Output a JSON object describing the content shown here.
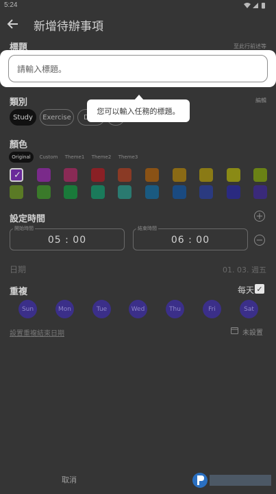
{
  "status_bar": {
    "time": "5:24"
  },
  "app_bar": {
    "title": "新增待辦事項"
  },
  "title_section": {
    "label": "標題",
    "hint_right": "至此行前述等",
    "input_placeholder": "請輸入標題。"
  },
  "tooltip": {
    "text": "您可以輸入任務的標題。"
  },
  "category_section": {
    "label": "類別",
    "edit_label": "編輯",
    "chips": [
      "Study",
      "Exercise",
      "D"
    ],
    "selected": "Study"
  },
  "color_section": {
    "label": "顏色",
    "theme_tabs": [
      "Original",
      "Custom",
      "Theme1",
      "Theme2",
      "Theme3"
    ],
    "selected_tab": "Original",
    "swatches_row1": [
      "#6a2a9a",
      "#7a2a8a",
      "#8a2a55",
      "#8a2025",
      "#8a3a25",
      "#8a5215",
      "#8a6a15",
      "#8a7a15",
      "#8a8a15",
      "#6a8215"
    ],
    "swatches_row2": [
      "#5a7a25",
      "#3a7a2a",
      "#1a7a3a",
      "#1a7a5a",
      "#2a7a70",
      "#1a5a80",
      "#1a4a80",
      "#2a3a80",
      "#2a2a80",
      "#3a2a7a"
    ],
    "selected_swatch": 0
  },
  "time_section": {
    "label": "設定時間",
    "start_caption": "開始時間",
    "start_value": "05 : 00",
    "end_caption": "結束時間",
    "end_value": "06 : 00"
  },
  "date_section": {
    "label": "日期",
    "value": "01. 03. 週五"
  },
  "repeat_section": {
    "label": "重複",
    "everyday_label": "每天",
    "everyday_checked": true,
    "days": [
      "Sun",
      "Mon",
      "Tue",
      "Wed",
      "Thu",
      "Fri",
      "Sat"
    ],
    "end_date_label": "設置重複結束日期",
    "end_date_value": "未設置"
  },
  "bottom_bar": {
    "cancel_label": "取消"
  },
  "colors": {
    "background": "#353535",
    "accent_day": "#3b2f89",
    "spotlight": "#ffffff"
  }
}
